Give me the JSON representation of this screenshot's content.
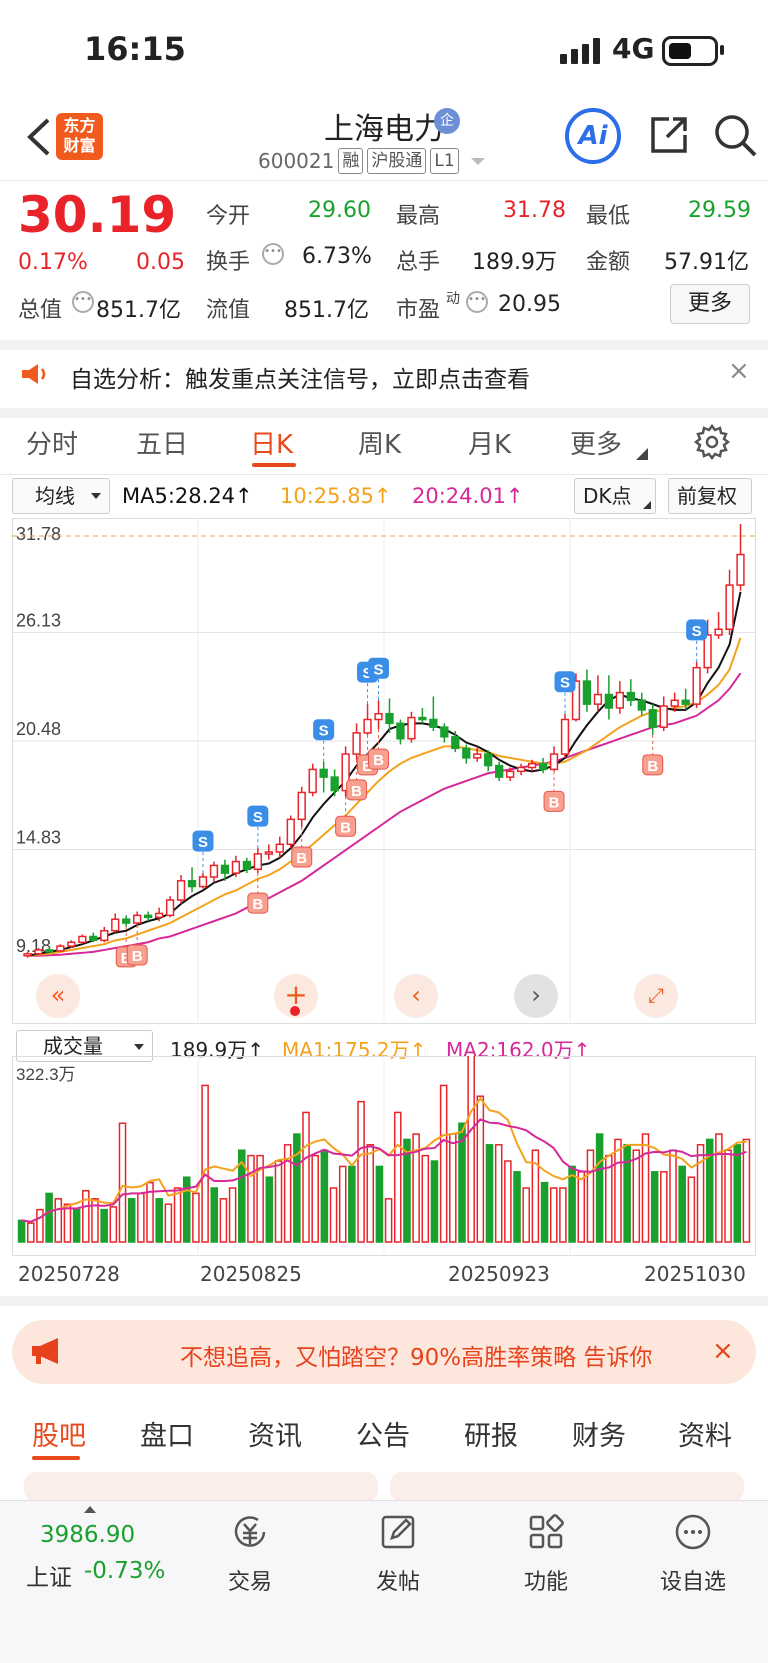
{
  "status": {
    "time": "16:15",
    "network": "4G"
  },
  "header": {
    "name": "上海电力",
    "badge": "企",
    "code": "600021",
    "tags": [
      "融",
      "沪股通",
      "L1"
    ],
    "ai": "Ai",
    "logo": [
      "东方",
      "财富"
    ]
  },
  "quote": {
    "price": "30.19",
    "change_pct": "0.17%",
    "change": "0.05",
    "open_label": "今开",
    "open": "29.60",
    "high_label": "最高",
    "high": "31.78",
    "low_label": "最低",
    "low": "29.59",
    "turnover_label": "换手",
    "turnover": "6.73%",
    "volume_label": "总手",
    "volume": "189.9万",
    "amount_label": "金额",
    "amount": "57.91亿",
    "mktcap_label": "总值",
    "mktcap": "851.7亿",
    "float_label": "流值",
    "float": "851.7亿",
    "pe_label": "市盈",
    "pe_sup": "动",
    "pe": "20.95",
    "more": "更多"
  },
  "notice": {
    "text": "自选分析：触发重点关注信号，立即点击查看",
    "close": "×"
  },
  "tabs": [
    "分时",
    "五日",
    "日K",
    "周K",
    "月K",
    "更多"
  ],
  "active_tab": 2,
  "chart_controls": {
    "ma_select": "均线",
    "ma5": "MA5:28.24↑",
    "ma10": "10:25.85↑",
    "ma20": "20:24.01↑",
    "dk": "DK点",
    "adjust": "前复权"
  },
  "colors": {
    "up": "#e8242a",
    "down": "#19a02d",
    "ma5": "#111111",
    "ma10": "#f4a21c",
    "ma20": "#d6289a"
  },
  "chart_data": {
    "type": "candlestick",
    "y_ticks": [
      "31.78",
      "26.13",
      "20.48",
      "14.83",
      "9.18"
    ],
    "ylim": [
      9.18,
      31.78
    ],
    "candles": [
      [
        9.3,
        9.4,
        9.5,
        9.2
      ],
      [
        9.4,
        9.6,
        9.7,
        9.35
      ],
      [
        9.6,
        9.55,
        9.8,
        9.5
      ],
      [
        9.55,
        9.8,
        9.9,
        9.5
      ],
      [
        9.8,
        10.0,
        10.1,
        9.7
      ],
      [
        10.0,
        10.3,
        10.4,
        9.9
      ],
      [
        10.3,
        10.1,
        10.5,
        10.0
      ],
      [
        10.1,
        10.6,
        10.8,
        10.0
      ],
      [
        10.6,
        11.2,
        11.5,
        10.5
      ],
      [
        11.2,
        11.0,
        11.4,
        10.8
      ],
      [
        11.0,
        11.4,
        11.6,
        10.9
      ],
      [
        11.4,
        11.3,
        11.6,
        11.1
      ],
      [
        11.3,
        11.5,
        11.8,
        11.1
      ],
      [
        11.4,
        12.2,
        12.4,
        11.3
      ],
      [
        12.2,
        13.2,
        13.5,
        12.0
      ],
      [
        13.2,
        12.9,
        13.9,
        12.6
      ],
      [
        12.9,
        13.4,
        13.6,
        12.8
      ],
      [
        13.4,
        14.0,
        14.2,
        13.1
      ],
      [
        14.0,
        13.6,
        14.3,
        13.2
      ],
      [
        13.6,
        14.2,
        14.5,
        13.4
      ],
      [
        14.2,
        13.8,
        14.4,
        13.6
      ],
      [
        13.8,
        14.6,
        14.9,
        13.6
      ],
      [
        14.6,
        14.7,
        15.1,
        14.3
      ],
      [
        14.7,
        15.1,
        15.5,
        14.4
      ],
      [
        15.1,
        16.4,
        16.6,
        14.9
      ],
      [
        16.4,
        17.8,
        18.1,
        16.0
      ],
      [
        17.8,
        19.0,
        19.3,
        17.6
      ],
      [
        19.0,
        18.6,
        19.4,
        17.8
      ],
      [
        18.6,
        17.9,
        19.0,
        17.6
      ],
      [
        17.9,
        19.8,
        20.2,
        17.6
      ],
      [
        19.8,
        20.9,
        21.4,
        19.5
      ],
      [
        20.9,
        21.6,
        22.4,
        20.8
      ],
      [
        21.6,
        21.9,
        22.6,
        21.1
      ],
      [
        21.9,
        21.4,
        22.7,
        20.9
      ],
      [
        21.4,
        20.6,
        21.6,
        20.3
      ],
      [
        20.6,
        21.7,
        22.0,
        20.4
      ],
      [
        21.7,
        21.6,
        22.2,
        21.4
      ],
      [
        21.6,
        21.2,
        22.8,
        21.0
      ],
      [
        21.2,
        20.7,
        21.4,
        20.4
      ],
      [
        20.7,
        20.1,
        21.0,
        19.9
      ],
      [
        20.1,
        19.6,
        20.3,
        19.3
      ],
      [
        19.6,
        19.8,
        20.2,
        19.4
      ],
      [
        19.8,
        19.2,
        20.0,
        18.9
      ],
      [
        19.2,
        18.6,
        19.4,
        18.4
      ],
      [
        18.6,
        18.9,
        19.1,
        18.4
      ],
      [
        18.9,
        19.1,
        19.3,
        18.7
      ],
      [
        19.1,
        19.3,
        19.5,
        18.9
      ],
      [
        19.3,
        19.0,
        19.6,
        18.8
      ],
      [
        19.0,
        19.8,
        20.2,
        18.9
      ],
      [
        19.8,
        21.6,
        21.9,
        19.6
      ],
      [
        21.6,
        23.6,
        24.0,
        21.5
      ],
      [
        23.6,
        22.4,
        24.2,
        22.0
      ],
      [
        22.4,
        22.9,
        23.9,
        22.0
      ],
      [
        22.9,
        22.2,
        23.9,
        21.6
      ],
      [
        22.2,
        23.0,
        23.6,
        21.9
      ],
      [
        23.0,
        22.6,
        23.7,
        22.3
      ],
      [
        22.6,
        22.1,
        23.0,
        21.8
      ],
      [
        22.1,
        21.2,
        22.4,
        20.8
      ],
      [
        21.2,
        22.3,
        22.8,
        21.0
      ],
      [
        22.3,
        22.6,
        23.0,
        22.0
      ],
      [
        22.6,
        22.4,
        23.2,
        22.1
      ],
      [
        22.4,
        24.3,
        24.6,
        22.2
      ],
      [
        24.3,
        26.0,
        26.8,
        24.0
      ],
      [
        26.0,
        26.3,
        27.2,
        25.8
      ],
      [
        26.3,
        28.6,
        29.4,
        26.0
      ],
      [
        28.6,
        30.19,
        31.78,
        28.3
      ]
    ],
    "ma5": [
      9.3,
      9.4,
      9.5,
      9.6,
      9.75,
      9.9,
      10.1,
      10.3,
      10.5,
      10.6,
      10.9,
      11.1,
      11.25,
      11.5,
      12.0,
      12.4,
      12.7,
      13.1,
      13.3,
      13.6,
      13.8,
      14.0,
      14.1,
      14.4,
      14.9,
      15.6,
      16.5,
      17.2,
      17.8,
      18.4,
      19.2,
      19.8,
      20.4,
      21.1,
      21.3,
      21.4,
      21.4,
      21.3,
      21.1,
      20.8,
      20.4,
      20.2,
      19.9,
      19.5,
      19.2,
      19.0,
      18.9,
      19.0,
      19.2,
      19.6,
      20.5,
      21.3,
      22.0,
      22.6,
      22.9,
      22.7,
      22.6,
      22.4,
      22.2,
      22.1,
      22.1,
      22.5,
      23.5,
      24.3,
      25.5,
      28.24
    ],
    "ma10": [
      9.3,
      9.35,
      9.4,
      9.5,
      9.6,
      9.7,
      9.8,
      9.9,
      10.1,
      10.2,
      10.4,
      10.6,
      10.8,
      11.0,
      11.3,
      11.6,
      11.9,
      12.2,
      12.5,
      12.7,
      13.0,
      13.3,
      13.5,
      13.8,
      14.2,
      14.6,
      15.1,
      15.6,
      16.1,
      16.6,
      17.2,
      17.8,
      18.4,
      18.9,
      19.3,
      19.6,
      19.8,
      20.0,
      20.2,
      20.2,
      20.1,
      20.0,
      19.9,
      19.7,
      19.6,
      19.5,
      19.4,
      19.3,
      19.3,
      19.4,
      19.7,
      20.0,
      20.4,
      20.8,
      21.2,
      21.5,
      21.8,
      22.0,
      22.1,
      22.2,
      22.3,
      22.5,
      22.9,
      23.4,
      24.2,
      25.85
    ],
    "ma20": [
      9.3,
      9.3,
      9.32,
      9.35,
      9.4,
      9.45,
      9.5,
      9.6,
      9.7,
      9.8,
      9.9,
      10.0,
      10.2,
      10.3,
      10.5,
      10.7,
      10.9,
      11.1,
      11.3,
      11.5,
      11.8,
      12.0,
      12.3,
      12.6,
      12.9,
      13.2,
      13.6,
      14.0,
      14.4,
      14.8,
      15.2,
      15.6,
      16.0,
      16.4,
      16.8,
      17.1,
      17.4,
      17.7,
      18.0,
      18.2,
      18.4,
      18.6,
      18.8,
      18.9,
      19.0,
      19.1,
      19.2,
      19.3,
      19.4,
      19.6,
      19.8,
      20.0,
      20.2,
      20.4,
      20.6,
      20.8,
      21.0,
      21.2,
      21.3,
      21.4,
      21.6,
      21.8,
      22.2,
      22.6,
      23.2,
      24.01
    ],
    "markers_buy": [
      9,
      10,
      21,
      25,
      29,
      30,
      31,
      32,
      48,
      57
    ],
    "markers_sell": [
      16,
      21,
      27,
      31,
      32,
      49,
      61
    ],
    "volume_label": "成交量",
    "volume_value": "189.9万↑",
    "vol_ma1": "MA1:175.2万↑",
    "vol_ma2": "MA2:162.0万↑",
    "vol_max": "322.3万",
    "volume": [
      40,
      35,
      60,
      90,
      80,
      70,
      60,
      95,
      80,
      60,
      65,
      220,
      80,
      90,
      110,
      80,
      70,
      100,
      120,
      90,
      290,
      100,
      80,
      100,
      170,
      160,
      160,
      120,
      150,
      180,
      200,
      240,
      160,
      170,
      100,
      140,
      140,
      260,
      180,
      140,
      80,
      240,
      190,
      200,
      160,
      150,
      290,
      200,
      220,
      350,
      270,
      180,
      180,
      150,
      130,
      100,
      170,
      110,
      100,
      100,
      140,
      130,
      170,
      200,
      160,
      190,
      180,
      170,
      200,
      130,
      130,
      170,
      140,
      120,
      180,
      190,
      200,
      170,
      180,
      190
    ],
    "x_labels": [
      "20250728",
      "20250825",
      "20250923",
      "20251030"
    ]
  },
  "promo": {
    "text": "不想追高，又怕踏空？90%高胜率策略 告诉你",
    "close": "×"
  },
  "bottom_tabs": [
    "股吧",
    "盘口",
    "资讯",
    "公告",
    "研报",
    "财务",
    "资料"
  ],
  "footer": {
    "index_value": "3986.90",
    "index_name": "上证",
    "index_change": "-0.73%",
    "items": [
      "交易",
      "发帖",
      "功能",
      "设自选"
    ]
  }
}
